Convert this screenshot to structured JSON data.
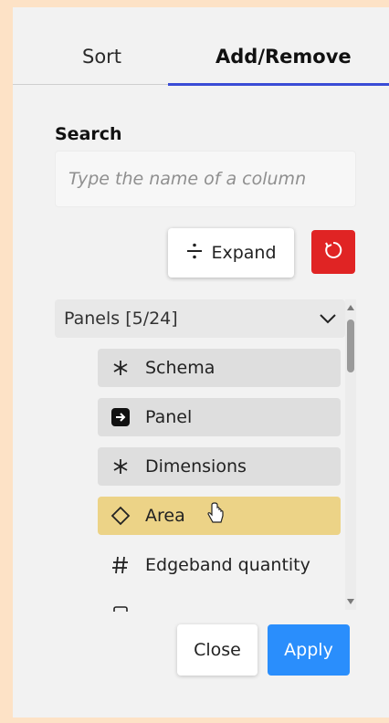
{
  "tabs": [
    {
      "label": "Sort"
    },
    {
      "label": "Add/Remove",
      "active": true
    }
  ],
  "search": {
    "label": "Search",
    "placeholder": "Type the name of a column"
  },
  "toolbar": {
    "expand_label": "Expand",
    "reset_icon": "reset-icon"
  },
  "group": {
    "label": "Panels [5/24]",
    "expanded": true
  },
  "columns": [
    {
      "label": "Schema",
      "icon": "asterisk-icon",
      "state": "selected"
    },
    {
      "label": "Panel",
      "icon": "arrow-right-square-icon",
      "state": "selected"
    },
    {
      "label": "Dimensions",
      "icon": "asterisk-icon",
      "state": "selected"
    },
    {
      "label": "Area",
      "icon": "diamond-icon",
      "state": "hover"
    },
    {
      "label": "Edgeband quantity",
      "icon": "hash-icon",
      "state": "unselected"
    }
  ],
  "footer": {
    "close_label": "Close",
    "apply_label": "Apply"
  },
  "colors": {
    "accent": "#3a4cd6",
    "apply": "#2a8efc",
    "reset": "#e02424",
    "hover": "#ecd387"
  }
}
